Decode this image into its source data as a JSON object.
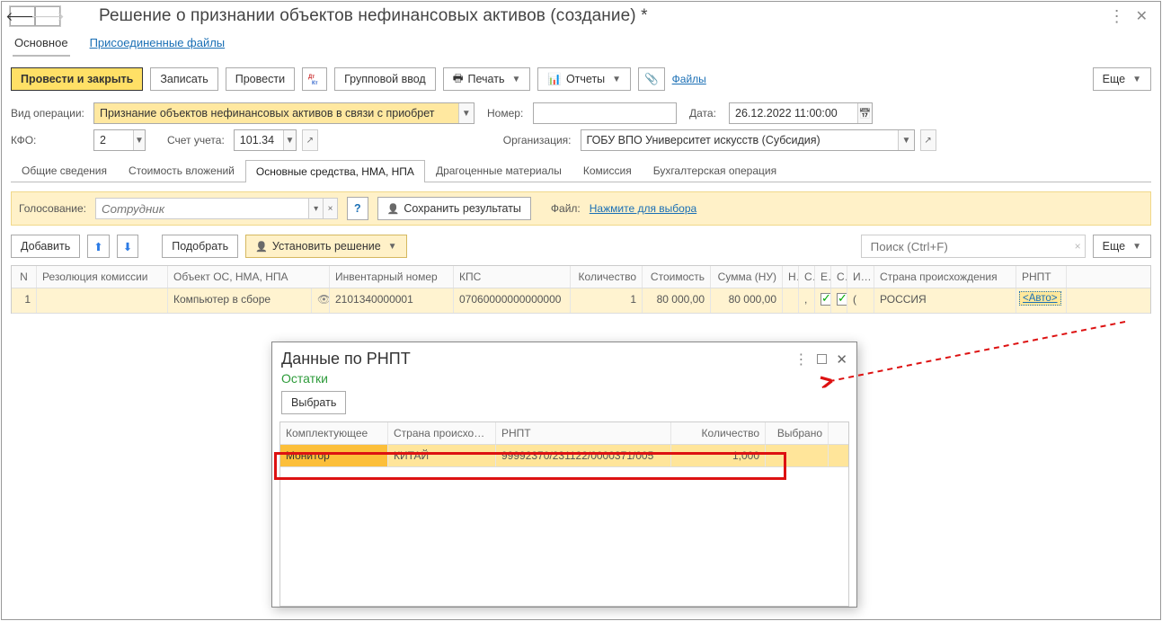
{
  "title": "Решение о признании объектов нефинансовых активов (создание) *",
  "subtabs": {
    "main": "Основное",
    "files": "Присоединенные файлы"
  },
  "toolbar": {
    "postAndClose": "Провести и закрыть",
    "save": "Записать",
    "post": "Провести",
    "groupInput": "Групповой ввод",
    "print": "Печать",
    "reports": "Отчеты",
    "files": "Файлы",
    "more": "Еще"
  },
  "form": {
    "opType_label": "Вид операции:",
    "opType_value": "Признание объектов нефинансовых активов в связи с приобрет",
    "number_label": "Номер:",
    "number_value": "",
    "date_label": "Дата:",
    "date_value": "26.12.2022 11:00:00",
    "kfo_label": "КФО:",
    "kfo_value": "2",
    "account_label": "Счет учета:",
    "account_value": "101.34",
    "org_label": "Организация:",
    "org_value": "ГОБУ ВПО Университет искусств (Субсидия)"
  },
  "tabs": {
    "t1": "Общие сведения",
    "t2": "Стоимость вложений",
    "t3": "Основные средства, НМА, НПА",
    "t4": "Драгоценные материалы",
    "t5": "Комиссия",
    "t6": "Бухгалтерская операция"
  },
  "voting": {
    "label": "Голосование:",
    "placeholder": "Сотрудник",
    "helpTip": "?",
    "saveResults": "Сохранить результаты",
    "file_label": "Файл:",
    "file_link": "Нажмите для выбора"
  },
  "tableToolbar": {
    "add": "Добавить",
    "pick": "Подобрать",
    "setDecision": "Установить решение",
    "searchPlaceholder": "Поиск (Ctrl+F)",
    "more": "Еще"
  },
  "columns": {
    "n": "N",
    "resolution": "Резолюция комиссии",
    "object": "Объект ОС, НМА, НПА",
    "inv": "Инвентарный номер",
    "kps": "КПС",
    "qty": "Количество",
    "cost": "Стоимость",
    "sumNU": "Сумма (НУ)",
    "h": "Н",
    "c1": "С",
    "e": "Е",
    "c2": "С",
    "i": "И…",
    "country": "Страна происхождения",
    "rnpt": "РНПТ"
  },
  "row": {
    "n": "1",
    "resolution": "",
    "object": "Компьютер в сборе",
    "inv": "2101340000001",
    "kps": "07060000000000000",
    "qty": "1",
    "cost": "80 000,00",
    "sumNU": "80 000,00",
    "country": "РОССИЯ",
    "rnpt": "<Авто>"
  },
  "popup": {
    "title": "Данные по РНПТ",
    "sub": "Остатки",
    "select": "Выбрать",
    "cols": {
      "comp": "Комплектующее",
      "country": "Страна происхо…",
      "rnpt": "РНПТ",
      "qty": "Количество",
      "sel": "Выбрано"
    },
    "row": {
      "comp": "Монитор",
      "country": "КИТАЙ",
      "rnpt": "99992370/231122/0000371/005",
      "qty": "1,000",
      "sel": ""
    }
  }
}
